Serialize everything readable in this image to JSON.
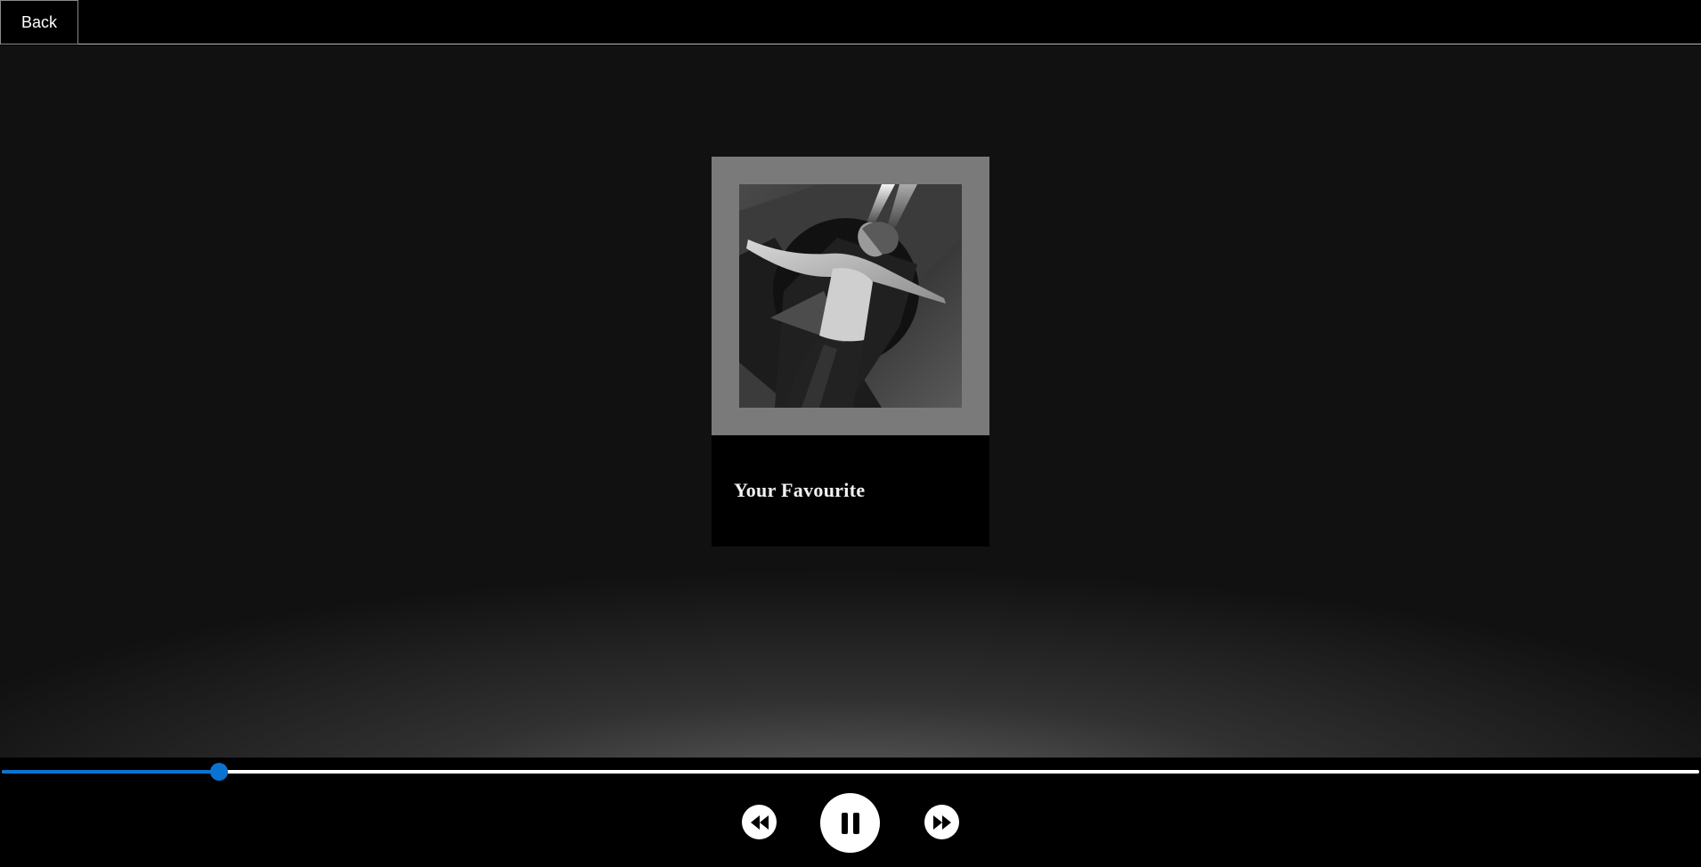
{
  "header": {
    "back_label": "Back"
  },
  "track": {
    "title": "Your Favourite",
    "artwork": "grayscale photo of a person with arms outstretched"
  },
  "player": {
    "progress_fraction": 0.128,
    "accent_color": "#0a73d0",
    "controls": {
      "rewind_icon": "rewind-icon",
      "pause_icon": "pause-icon",
      "forward_icon": "fast-forward-icon"
    }
  }
}
